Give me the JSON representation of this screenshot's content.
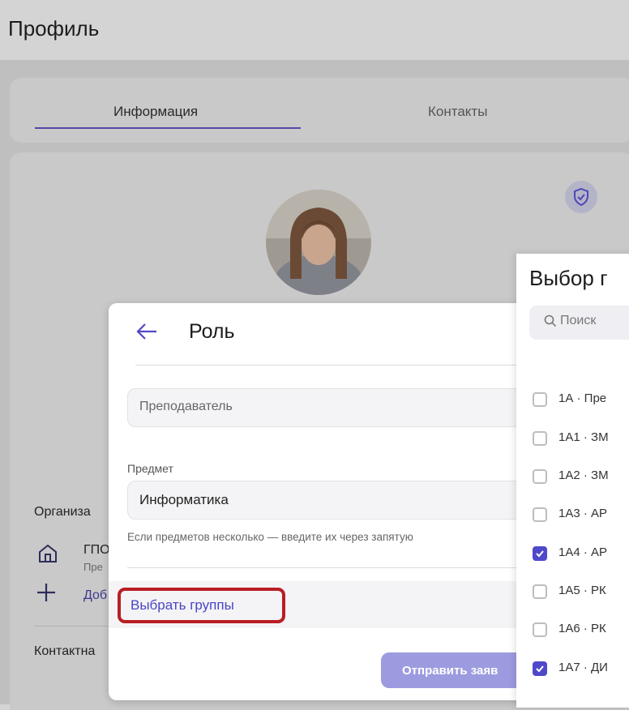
{
  "header": {
    "title": "Профиль"
  },
  "tabs": [
    {
      "label": "Информация",
      "active": true
    },
    {
      "label": "Контакты",
      "active": false
    }
  ],
  "profile": {
    "avatar": "user-photo",
    "badge_icon": "shield-check-icon"
  },
  "organization": {
    "section_label": "Организа",
    "org_name": "ГПО",
    "org_sub": "Пре",
    "add_label": "Доб"
  },
  "contacts_section": {
    "label": "Контактна"
  },
  "role_dialog": {
    "title": "Роль",
    "role_value": "Преподаватель",
    "subject_label": "Предмет",
    "subject_value": "Информатика",
    "subject_hint": "Если предметов несколько — введите их через запятую",
    "select_groups_label": "Выбрать группы",
    "submit_label": "Отправить заяв"
  },
  "groups_panel": {
    "title": "Выбор г",
    "search_placeholder": "Поиск",
    "items": [
      {
        "label": "1А · Пре",
        "checked": false
      },
      {
        "label": "1А1 · ЗМ",
        "checked": false
      },
      {
        "label": "1А2 · ЗМ",
        "checked": false
      },
      {
        "label": "1А3 · АР",
        "checked": false
      },
      {
        "label": "1А4 · АР",
        "checked": true
      },
      {
        "label": "1А5 · РК",
        "checked": false
      },
      {
        "label": "1А6 · РК",
        "checked": false
      },
      {
        "label": "1А7 · ДИ",
        "checked": true
      }
    ]
  },
  "colors": {
    "accent": "#4f49c9",
    "highlight": "#b81e25",
    "button_disabled": "#9d9be0"
  }
}
